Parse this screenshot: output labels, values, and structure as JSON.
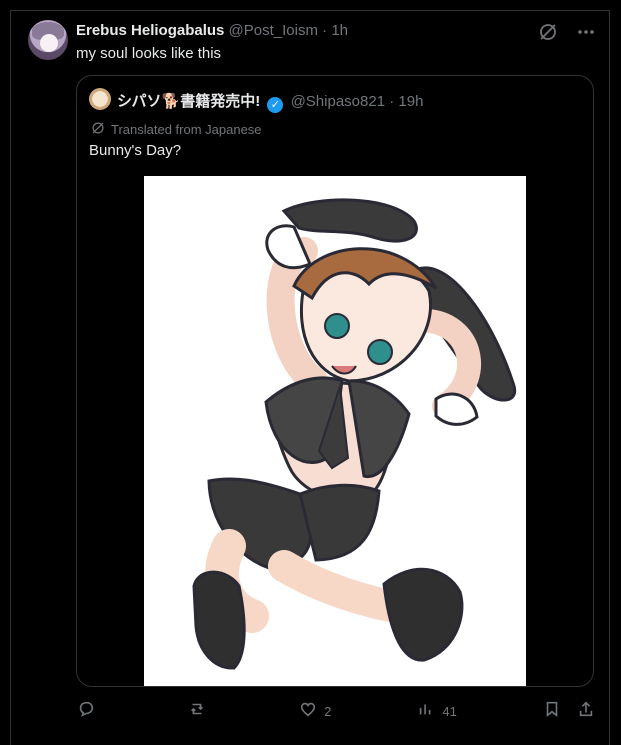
{
  "tweet": {
    "author_name": "Erebus Heliogabalus",
    "author_handle": "@Post_Ioism",
    "separator": "·",
    "time": "1h",
    "text": "my soul looks like this"
  },
  "quote": {
    "author_name": "シパソ🐕書籍発売中!",
    "verified_icon": "verified-check-icon",
    "author_handle": "@Shipaso821",
    "separator": "·",
    "time": "19h",
    "translated_label": "Translated from Japanese",
    "text": "Bunny's Day?",
    "image_alt": "Illustration of a boy in a bunny outfit"
  },
  "actions": {
    "reply_count": "",
    "retweet_count": "",
    "like_count": "2",
    "views_count": "41"
  },
  "icons": {
    "grok": "grok-icon",
    "more": "more-icon",
    "translate": "translate-icon",
    "reply": "reply-icon",
    "retweet": "retweet-icon",
    "like": "heart-icon",
    "views": "views-icon",
    "bookmark": "bookmark-icon",
    "share": "share-icon"
  },
  "colors": {
    "background": "#000000",
    "text": "#e7e9ea",
    "secondary": "#71767b",
    "border": "#2f3336",
    "verified": "#1d9bf0"
  }
}
